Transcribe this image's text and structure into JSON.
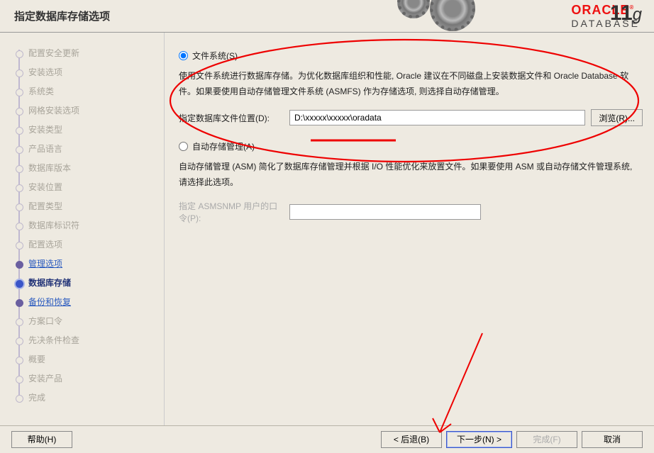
{
  "header": {
    "title": "指定数据库存储选项",
    "brand_top": "ORACLE",
    "brand_bottom": "DATABASE",
    "brand_version": "11",
    "brand_version_suffix": "g"
  },
  "sidebar": {
    "items": [
      {
        "label": "配置安全更新",
        "state": "done"
      },
      {
        "label": "安装选项",
        "state": "done"
      },
      {
        "label": "系统类",
        "state": "done"
      },
      {
        "label": "网格安装选项",
        "state": "done"
      },
      {
        "label": "安装类型",
        "state": "done"
      },
      {
        "label": "产品语言",
        "state": "done"
      },
      {
        "label": "数据库版本",
        "state": "done"
      },
      {
        "label": "安装位置",
        "state": "done"
      },
      {
        "label": "配置类型",
        "state": "done"
      },
      {
        "label": "数据库标识符",
        "state": "done"
      },
      {
        "label": "配置选项",
        "state": "done"
      },
      {
        "label": "管理选项",
        "state": "link"
      },
      {
        "label": "数据库存储",
        "state": "current"
      },
      {
        "label": "备份和恢复",
        "state": "link"
      },
      {
        "label": "方案口令",
        "state": "done"
      },
      {
        "label": "先决条件检查",
        "state": "done"
      },
      {
        "label": "概要",
        "state": "done"
      },
      {
        "label": "安装产品",
        "state": "done"
      },
      {
        "label": "完成",
        "state": "done"
      }
    ]
  },
  "main": {
    "option_fs": {
      "label": "文件系统(S)",
      "desc": "使用文件系统进行数据库存储。为优化数据库组织和性能, Oracle 建议在不同磁盘上安装数据文件和 Oracle Database 软件。如果要使用自动存储管理文件系统 (ASMFS) 作为存储选项, 则选择自动存储管理。",
      "path_label": "指定数据库文件位置(D):",
      "path_value": "D:\\xxxxx\\xxxxx\\oradata",
      "browse": "浏览(R)..."
    },
    "option_asm": {
      "label": "自动存储管理(A)",
      "desc": "自动存储管理 (ASM) 简化了数据库存储管理并根据 I/O 性能优化来放置文件。如果要使用 ASM 或自动存储文件管理系统, 请选择此选项。",
      "pw_label": "指定 ASMSNMP 用户的口令(P):"
    }
  },
  "footer": {
    "help": "帮助(H)",
    "back": "< 后退(B)",
    "next": "下一步(N) >",
    "finish": "完成(F)",
    "cancel": "取消"
  }
}
